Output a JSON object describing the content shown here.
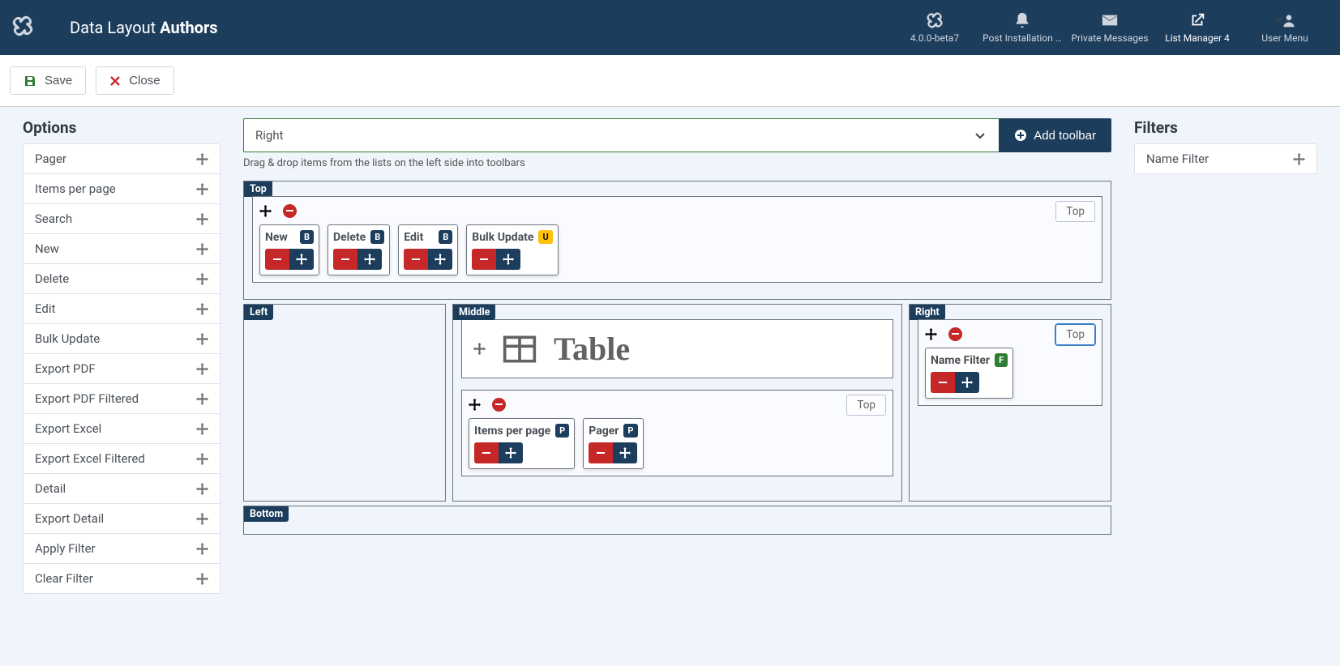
{
  "header": {
    "title_prefix": "Data Layout ",
    "title_bold": "Authors",
    "status": [
      {
        "label": "4.0.0-beta7"
      },
      {
        "label": "Post Installation …"
      },
      {
        "label": "Private Messages"
      },
      {
        "label": "List Manager 4",
        "active": true
      },
      {
        "label": "User Menu"
      }
    ]
  },
  "toolbar": {
    "save_label": "Save",
    "close_label": "Close"
  },
  "options": {
    "heading": "Options",
    "items": [
      "Pager",
      "Items per page",
      "Search",
      "New",
      "Delete",
      "Edit",
      "Bulk Update",
      "Export PDF",
      "Export PDF Filtered",
      "Export Excel",
      "Export Excel Filtered",
      "Detail",
      "Export Detail",
      "Apply Filter",
      "Clear Filter"
    ]
  },
  "filters": {
    "heading": "Filters",
    "items": [
      "Name Filter"
    ]
  },
  "center": {
    "select_value": "Right",
    "add_label": "Add toolbar",
    "hint": "Drag & drop items from the lists on the left side into toolbars",
    "labels": {
      "top": "Top",
      "left": "Left",
      "middle": "Middle",
      "right": "Right",
      "bottom": "Bottom"
    },
    "table_label": "Table",
    "tag_top": "Top",
    "top_toolbar_items": [
      {
        "name": "New",
        "badge": "B",
        "badgeClass": ""
      },
      {
        "name": "Delete",
        "badge": "B",
        "badgeClass": ""
      },
      {
        "name": "Edit",
        "badge": "B",
        "badgeClass": ""
      },
      {
        "name": "Bulk Update",
        "badge": "U",
        "badgeClass": "yellow"
      }
    ],
    "middle_toolbar_items": [
      {
        "name": "Items per page",
        "badge": "P",
        "badgeClass": ""
      },
      {
        "name": "Pager",
        "badge": "P",
        "badgeClass": ""
      }
    ],
    "right_toolbar_items": [
      {
        "name": "Name Filter",
        "badge": "F",
        "badgeClass": "green"
      }
    ]
  }
}
